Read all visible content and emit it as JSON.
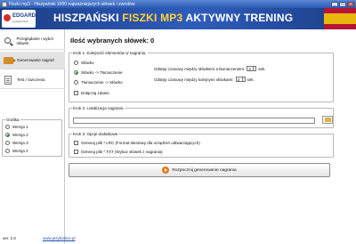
{
  "window": {
    "title": "Fiszki mp3 - Hiszpański 1000 najważniejszych słówek i zwrotów",
    "controls": [
      "_",
      "□",
      "×"
    ]
  },
  "banner": {
    "logo_text": "EDGARD",
    "logo_sub": "wydawnictwo",
    "title_part1": "HISZPAŃSKI",
    "title_part2": "FISZKI MP3",
    "title_part3": "AKTYWNY TRENING"
  },
  "sidebar": {
    "items": [
      {
        "label": "Przeglądanie i wybór słówek",
        "icon": "magnifier-icon"
      },
      {
        "label": "Generowanie nagrań",
        "icon": "camera-icon"
      },
      {
        "label": "Test / ćwiczenia",
        "icon": "document-icon"
      }
    ],
    "grafika": {
      "title": "Grafika",
      "options": [
        "Wersja 1",
        "Wersja 2",
        "Wersja 3",
        "Wersja 4"
      ],
      "selected": "Wersja 2"
    },
    "version": "ver. 1.0",
    "link": "www.jezykiobce.pl"
  },
  "main": {
    "heading": "Ilość wybranych słówek: 0",
    "step1": {
      "title": "Krok 1: Kolejność elementów w nagraniu:",
      "options": [
        "Słówko",
        "Słówko -> Tłumaczenie",
        "Tłumaczenie -> Słówko"
      ],
      "selected": "Słówko -> Tłumaczenie",
      "attach_sentence": "Dołączaj zdanie",
      "gap1_label": "Odstęp czasowy między słówkiem a tłumaczeniem:",
      "gap1_value": "3",
      "gap2_label": "Odstęp czasowy między kolejnymi słówkami:",
      "gap2_value": "3",
      "unit": "sek."
    },
    "step2": {
      "title": "Krok 2: Lokalizacja nagrania",
      "path_value": ""
    },
    "step3": {
      "title": "Krok 3: Opcje dodatkowe",
      "opt_lrc": "Generuj plik *.LRC (Format tekstowy dla urządzeń odtwarzających)",
      "opt_txt": "Generuj plik *.TXT (Wykaz słówek z nagrania)"
    },
    "start_button": "Rozpocznij generowanie nagrania"
  }
}
